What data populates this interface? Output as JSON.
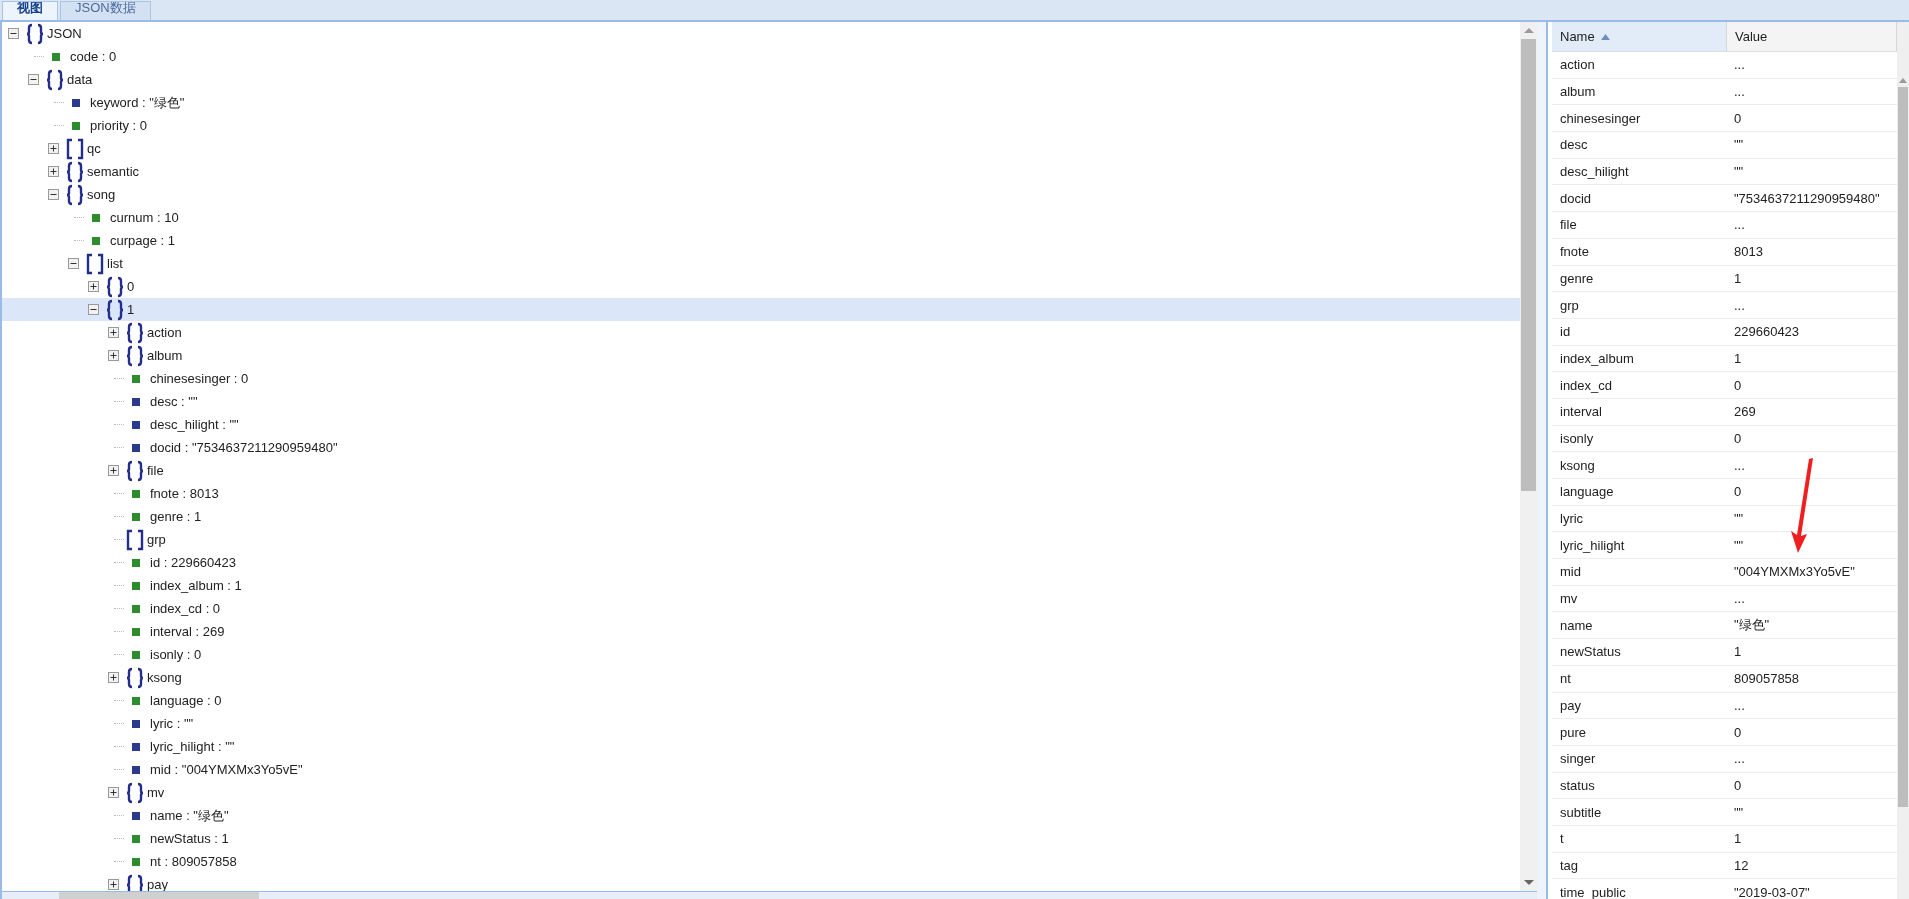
{
  "tabs": [
    {
      "label": "视图",
      "selected": true
    },
    {
      "label": "JSON数据",
      "selected": false
    }
  ],
  "tree": [
    {
      "label": "JSON",
      "kind": "object",
      "expanded": true,
      "selected": false,
      "children": [
        {
          "label": "code : 0",
          "kind": "number",
          "selected": false
        },
        {
          "label": "data",
          "kind": "object",
          "expanded": true,
          "selected": false,
          "children": [
            {
              "label": "keyword : \"绿色\"",
              "kind": "string",
              "selected": false
            },
            {
              "label": "priority : 0",
              "kind": "number",
              "selected": false
            },
            {
              "label": "qc",
              "kind": "array",
              "expanded": false,
              "selected": false
            },
            {
              "label": "semantic",
              "kind": "object",
              "expanded": false,
              "selected": false
            },
            {
              "label": "song",
              "kind": "object",
              "expanded": true,
              "selected": false,
              "children": [
                {
                  "label": "curnum : 10",
                  "kind": "number",
                  "selected": false
                },
                {
                  "label": "curpage : 1",
                  "kind": "number",
                  "selected": false
                },
                {
                  "label": "list",
                  "kind": "array",
                  "expanded": true,
                  "selected": false,
                  "children": [
                    {
                      "label": "0",
                      "kind": "object",
                      "expanded": false,
                      "selected": false
                    },
                    {
                      "label": "1",
                      "kind": "object",
                      "expanded": true,
                      "selected": true,
                      "children": [
                        {
                          "label": "action",
                          "kind": "object",
                          "expanded": false,
                          "selected": false
                        },
                        {
                          "label": "album",
                          "kind": "object",
                          "expanded": false,
                          "selected": false
                        },
                        {
                          "label": "chinesesinger : 0",
                          "kind": "number",
                          "selected": false
                        },
                        {
                          "label": "desc : \"\"",
                          "kind": "string",
                          "selected": false
                        },
                        {
                          "label": "desc_hilight : \"\"",
                          "kind": "string",
                          "selected": false
                        },
                        {
                          "label": "docid : \"7534637211290959480\"",
                          "kind": "string",
                          "selected": false
                        },
                        {
                          "label": "file",
                          "kind": "object",
                          "expanded": false,
                          "selected": false
                        },
                        {
                          "label": "fnote : 8013",
                          "kind": "number",
                          "selected": false
                        },
                        {
                          "label": "genre : 1",
                          "kind": "number",
                          "selected": false
                        },
                        {
                          "label": "grp",
                          "kind": "array",
                          "selected": false
                        },
                        {
                          "label": "id : 229660423",
                          "kind": "number",
                          "selected": false
                        },
                        {
                          "label": "index_album : 1",
                          "kind": "number",
                          "selected": false
                        },
                        {
                          "label": "index_cd : 0",
                          "kind": "number",
                          "selected": false
                        },
                        {
                          "label": "interval : 269",
                          "kind": "number",
                          "selected": false
                        },
                        {
                          "label": "isonly : 0",
                          "kind": "number",
                          "selected": false
                        },
                        {
                          "label": "ksong",
                          "kind": "object",
                          "expanded": false,
                          "selected": false
                        },
                        {
                          "label": "language : 0",
                          "kind": "number",
                          "selected": false
                        },
                        {
                          "label": "lyric : \"\"",
                          "kind": "string",
                          "selected": false
                        },
                        {
                          "label": "lyric_hilight : \"\"",
                          "kind": "string",
                          "selected": false
                        },
                        {
                          "label": "mid : \"004YMXMx3Yo5vE\"",
                          "kind": "string",
                          "selected": false
                        },
                        {
                          "label": "mv",
                          "kind": "object",
                          "expanded": false,
                          "selected": false
                        },
                        {
                          "label": "name : \"绿色\"",
                          "kind": "string",
                          "selected": false
                        },
                        {
                          "label": "newStatus : 1",
                          "kind": "number",
                          "selected": false
                        },
                        {
                          "label": "nt : 809057858",
                          "kind": "number",
                          "selected": false
                        },
                        {
                          "label": "pay",
                          "kind": "object",
                          "expanded": false,
                          "selected": false
                        }
                      ]
                    }
                  ]
                }
              ]
            }
          ]
        }
      ]
    }
  ],
  "properties": {
    "columns": [
      {
        "label": "Name",
        "sorted_ascending": true
      },
      {
        "label": "Value"
      }
    ],
    "rows": [
      {
        "name": "action",
        "value": "..."
      },
      {
        "name": "album",
        "value": "..."
      },
      {
        "name": "chinesesinger",
        "value": "0"
      },
      {
        "name": "desc",
        "value": "\"\""
      },
      {
        "name": "desc_hilight",
        "value": "\"\""
      },
      {
        "name": "docid",
        "value": "\"7534637211290959480\""
      },
      {
        "name": "file",
        "value": "..."
      },
      {
        "name": "fnote",
        "value": "8013"
      },
      {
        "name": "genre",
        "value": "1"
      },
      {
        "name": "grp",
        "value": "..."
      },
      {
        "name": "id",
        "value": "229660423"
      },
      {
        "name": "index_album",
        "value": "1"
      },
      {
        "name": "index_cd",
        "value": "0"
      },
      {
        "name": "interval",
        "value": "269"
      },
      {
        "name": "isonly",
        "value": "0"
      },
      {
        "name": "ksong",
        "value": "..."
      },
      {
        "name": "language",
        "value": "0"
      },
      {
        "name": "lyric",
        "value": "\"\""
      },
      {
        "name": "lyric_hilight",
        "value": "\"\""
      },
      {
        "name": "mid",
        "value": "\"004YMXMx3Yo5vE\""
      },
      {
        "name": "mv",
        "value": "..."
      },
      {
        "name": "name",
        "value": "\"绿色\""
      },
      {
        "name": "newStatus",
        "value": "1"
      },
      {
        "name": "nt",
        "value": "809057858"
      },
      {
        "name": "pay",
        "value": "..."
      },
      {
        "name": "pure",
        "value": "0"
      },
      {
        "name": "singer",
        "value": "..."
      },
      {
        "name": "status",
        "value": "0"
      },
      {
        "name": "subtitle",
        "value": "\"\""
      },
      {
        "name": "t",
        "value": "1"
      },
      {
        "name": "tag",
        "value": "12"
      },
      {
        "name": "time_public",
        "value": "\"2019-03-07\""
      }
    ]
  }
}
